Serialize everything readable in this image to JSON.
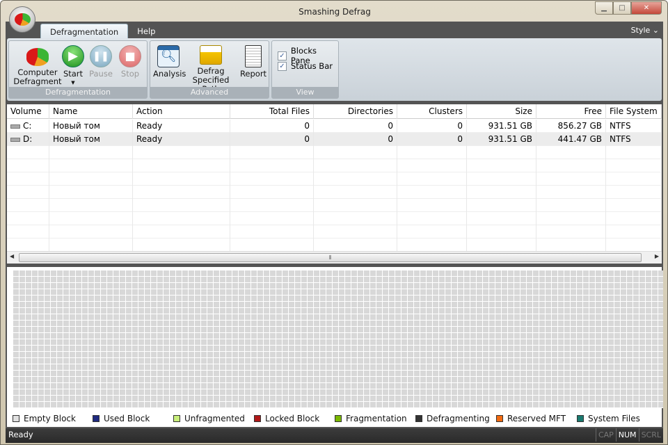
{
  "window": {
    "title": "Smashing Defrag"
  },
  "tabs": [
    {
      "label": "Defragmentation",
      "active": true
    },
    {
      "label": "Help",
      "active": false
    }
  ],
  "style_menu": "Style ⌄",
  "ribbon": {
    "groups": [
      {
        "label": "Defragmentation",
        "buttons": [
          {
            "label": "Computer Defragment"
          },
          {
            "label": "Start"
          },
          {
            "label": "Pause",
            "disabled": true
          },
          {
            "label": "Stop",
            "disabled": true
          }
        ]
      },
      {
        "label": "Advanced",
        "buttons": [
          {
            "label": "Analysis"
          },
          {
            "label": "Defrag Specified Path"
          },
          {
            "label": "Report"
          }
        ]
      },
      {
        "label": "View",
        "checkboxes": [
          {
            "label": "Blocks Pane",
            "checked": true
          },
          {
            "label": "Status Bar",
            "checked": true
          }
        ]
      }
    ]
  },
  "table": {
    "columns": [
      "Volume",
      "Name",
      "Action",
      "Total Files",
      "Directories",
      "Clusters",
      "Size",
      "Free",
      "File System"
    ],
    "rows": [
      [
        "C:",
        "Новый том",
        "Ready",
        "0",
        "0",
        "0",
        "931.51 GB",
        "856.27 GB",
        "NTFS"
      ],
      [
        "D:",
        "Новый том",
        "Ready",
        "0",
        "0",
        "0",
        "931.51 GB",
        "441.47 GB",
        "NTFS"
      ]
    ]
  },
  "legend": [
    {
      "label": "Empty Block",
      "color": "#e0e0e0"
    },
    {
      "label": "Used Block",
      "color": "#1f2a80"
    },
    {
      "label": "Unfragmented",
      "color": "#c8ee7a"
    },
    {
      "label": "Locked Block",
      "color": "#b01818"
    },
    {
      "label": "Fragmentation",
      "color": "#7ab800"
    },
    {
      "label": "Defragmenting",
      "color": "#333333"
    },
    {
      "label": "Reserved MFT",
      "color": "#f26a10"
    },
    {
      "label": "System Files",
      "color": "#1a7a70"
    }
  ],
  "status": {
    "text": "Ready",
    "keys": [
      {
        "label": "CAP",
        "on": false
      },
      {
        "label": "NUM",
        "on": true
      },
      {
        "label": "SCRL",
        "on": false
      }
    ]
  }
}
